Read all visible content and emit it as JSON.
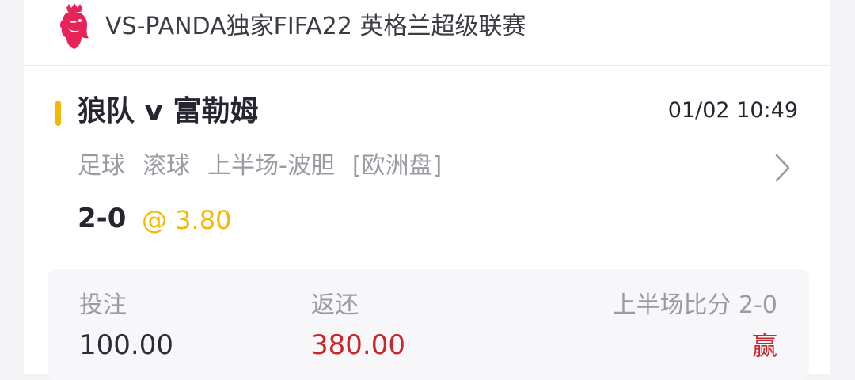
{
  "league": {
    "title": "VS-PANDA独家FIFA22 英格兰超级联赛",
    "logo_icon": "premier-league-lion-icon",
    "logo_color": "#e8235a"
  },
  "match": {
    "title": "狼队 v 富勒姆",
    "time": "01/02 10:49",
    "accent_color": "#f5b800"
  },
  "bet": {
    "sport": "足球",
    "mode": "滚球",
    "market": "上半场-波胆",
    "odds_type": "[欧洲盘]",
    "pick": "2-0",
    "odds": "@ 3.80",
    "detail_icon": "chevron-right-icon"
  },
  "summary": {
    "stake_label": "投注",
    "stake_value": "100.00",
    "return_label": "返还",
    "return_value": "380.00",
    "result_label": "上半场比分 2-0",
    "result_status": "赢",
    "return_color": "#c8262a"
  }
}
